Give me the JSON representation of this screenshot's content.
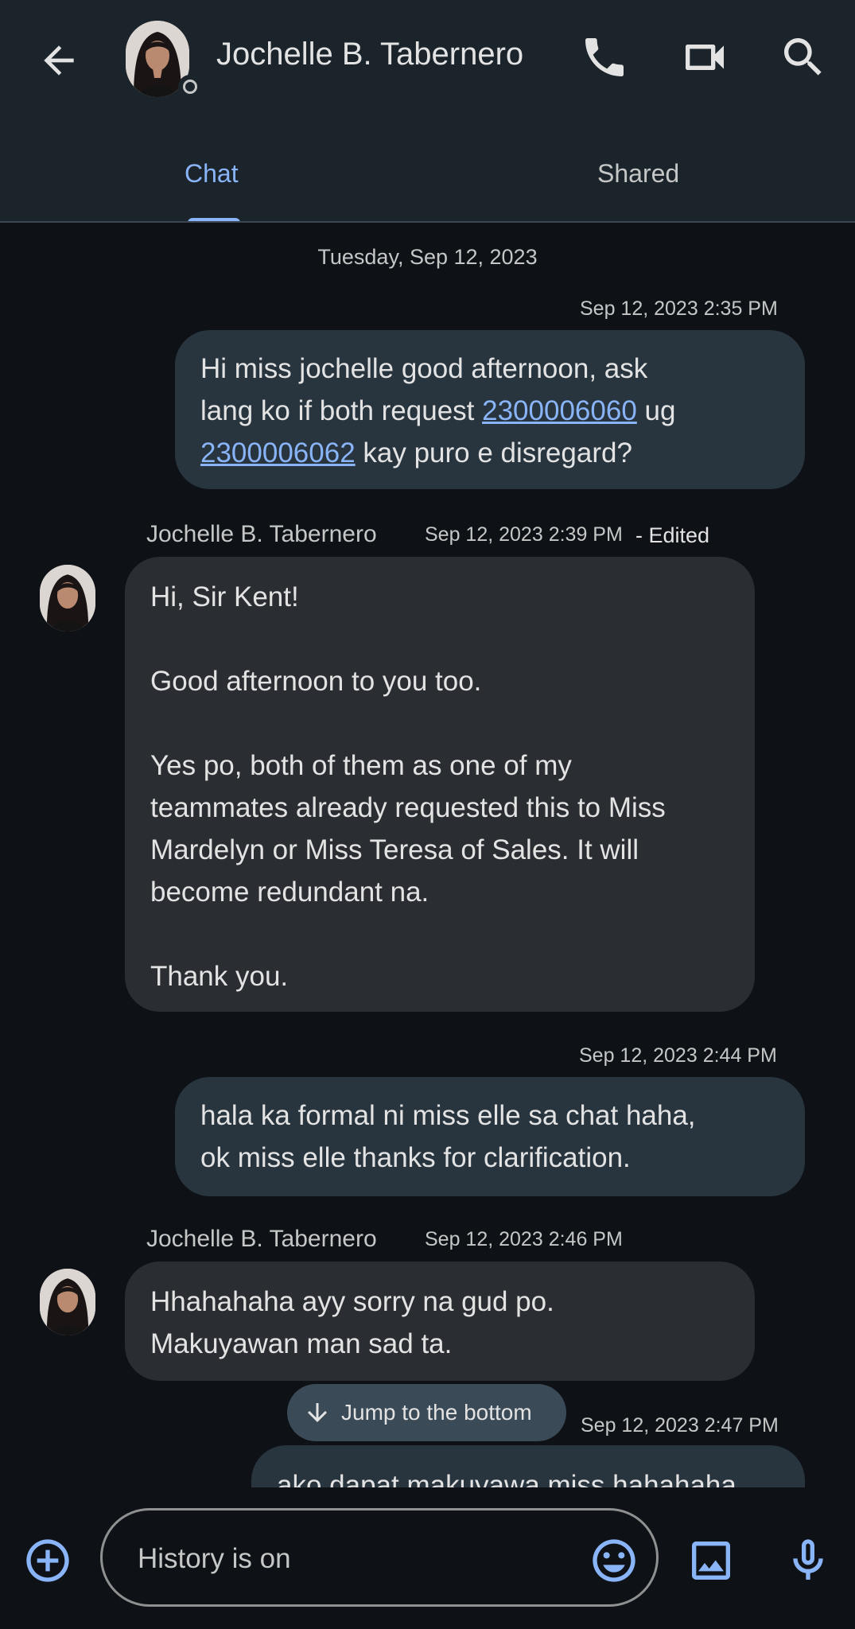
{
  "header": {
    "contact_name": "Jochelle B. Tabernero",
    "tabs": [
      {
        "label": "Chat",
        "active": true
      },
      {
        "label": "Shared",
        "active": false
      }
    ],
    "icons": [
      "back-arrow-icon",
      "phone-icon",
      "video-camera-icon",
      "search-icon"
    ]
  },
  "chat": {
    "date_separator": "Tuesday, Sep 12, 2023",
    "messages": [
      {
        "direction": "outgoing",
        "timestamp": "Sep 12, 2023 2:35 PM",
        "text_parts": [
          "Hi miss jochelle good afternoon, ask\nlang ko if both request ",
          "2300006060",
          " ug\n",
          "2300006062",
          " kay puro e disregard?"
        ]
      },
      {
        "direction": "incoming",
        "sender": "Jochelle B. Tabernero",
        "timestamp": "Sep 12, 2023 2:39 PM",
        "edited_label": "- Edited",
        "text": "Hi, Sir Kent!\n\nGood afternoon to you too.\n\nYes po, both of them as one of my\nteammates already requested this to Miss\nMardelyn or Miss Teresa of Sales. It will\nbecome redundant na.\n\nThank you."
      },
      {
        "direction": "outgoing",
        "timestamp": "Sep 12, 2023 2:44 PM",
        "text": "hala ka formal ni miss elle sa chat haha,\nok miss elle thanks for clarification."
      },
      {
        "direction": "incoming",
        "sender": "Jochelle B. Tabernero",
        "timestamp": "Sep 12, 2023 2:46 PM",
        "text": "Hhahahaha ayy sorry na gud po.\nMakuyawan man sad ta."
      },
      {
        "direction": "outgoing",
        "timestamp": "Sep 12, 2023 2:47 PM",
        "text": "ako dapat makuyawa miss hahahaha"
      }
    ],
    "jump_button_label": "Jump to the bottom"
  },
  "composer": {
    "placeholder": "History is on",
    "icons": [
      "add-circle-icon",
      "emoji-icon",
      "image-icon",
      "microphone-icon"
    ]
  },
  "colors": {
    "accent": "#8ab4f8",
    "background": "#0e1217",
    "header_bg": "#1b242b",
    "outgoing_bubble": "#28353f",
    "incoming_bubble": "#2a2d31"
  }
}
